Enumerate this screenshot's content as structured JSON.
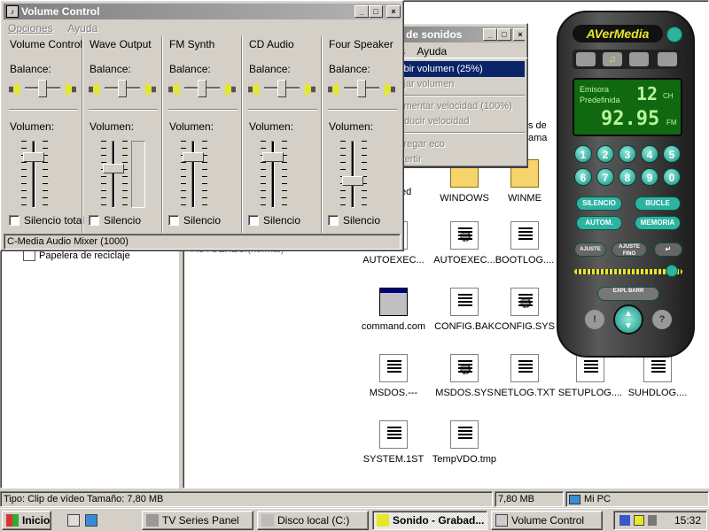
{
  "volume_control": {
    "title": "Volume Control",
    "menu": [
      "Opciones",
      "Ayuda"
    ],
    "channels": [
      {
        "name": "Volume Control",
        "balance_label": "Balance:",
        "volume_label": "Volumen:",
        "mute_label": "Silencio total",
        "volume_level": 0.8
      },
      {
        "name": "Wave Output",
        "balance_label": "Balance:",
        "volume_label": "Volumen:",
        "mute_label": "Silencio",
        "volume_level": 0.6
      },
      {
        "name": "FM Synth",
        "balance_label": "Balance:",
        "volume_label": "Volumen:",
        "mute_label": "Silencio",
        "volume_level": 0.8
      },
      {
        "name": "CD Audio",
        "balance_label": "Balance:",
        "volume_label": "Volumen:",
        "mute_label": "Silencio",
        "volume_level": 0.8
      },
      {
        "name": "Four Speaker",
        "balance_label": "Balance:",
        "volume_label": "Volumen:",
        "mute_label": "Silencio",
        "volume_level": 0.4
      }
    ],
    "status": "C-Media Audio Mixer (1000)"
  },
  "sound_window": {
    "title_partial": "de sonidos",
    "menu_partial": [
      "s",
      "Ayuda"
    ],
    "menu_items": [
      {
        "label": "Subir volumen (25%)",
        "highlighted": true
      },
      {
        "label": "Bajar volumen",
        "highlighted": false
      },
      {
        "label": "Aumentar velocidad (100%)",
        "highlighted": false
      },
      {
        "label": "Reducir velocidad",
        "highlighted": false
      },
      {
        "label": "Agregar eco",
        "highlighted": false
      },
      {
        "label": "Invertir",
        "highlighted": false
      }
    ]
  },
  "explorer": {
    "tree_item": "Papelera de reciclaje",
    "partial_texts": {
      "right_col": "s de",
      "right_col2": "ama",
      "left_col": "ed",
      "under_mixer": "AUTOEXEC.(normal)"
    },
    "icons": [
      {
        "label": "WINDOWS",
        "kind": "folder"
      },
      {
        "label": "WINME",
        "kind": "folder"
      },
      {
        "label": "AUTOEXEC...",
        "kind": "doc"
      },
      {
        "label": "AUTOEXEC...",
        "kind": "gear"
      },
      {
        "label": "BOOTLOG....",
        "kind": "doc"
      },
      {
        "label": "command.com",
        "kind": "win"
      },
      {
        "label": "CONFIG.BAK",
        "kind": "doc"
      },
      {
        "label": "CONFIG.SYS",
        "kind": "gear"
      },
      {
        "label": "MSDOS.---",
        "kind": "doc"
      },
      {
        "label": "MSDOS.SYS",
        "kind": "gear"
      },
      {
        "label": "NETLOG.TXT",
        "kind": "text"
      },
      {
        "label": "SETUPLOG....",
        "kind": "text"
      },
      {
        "label": "SUHDLOG....",
        "kind": "doc"
      },
      {
        "label": "SYSTEM.1ST",
        "kind": "doc"
      },
      {
        "label": "TempVDO.tmp",
        "kind": "doc"
      }
    ],
    "status": {
      "left": "Tipo: Clip de vídeo Tamaño: 7,80 MB",
      "size": "7,80 MB",
      "location": "Mi PC"
    }
  },
  "avermedia": {
    "brand": "AVerMedia",
    "display": {
      "line1": "Emisora",
      "line2": "Predefinida",
      "channel": "12",
      "channel_unit": "CH",
      "frequency": "92.95",
      "freq_unit": "FM"
    },
    "numbers": [
      "1",
      "2",
      "3",
      "4",
      "5",
      "6",
      "7",
      "8",
      "9",
      "0"
    ],
    "buttons": {
      "mute": "SILENCIO",
      "loop": "BUCLE",
      "auto": "AUTOM.",
      "memory": "MEMORIA",
      "fine_down": "AJUSTE",
      "fine_up": "AJUSTE FINO",
      "scan": "EXPL BARR"
    },
    "volume_level": 0.9
  },
  "taskbar": {
    "start": "Inicio",
    "tasks": [
      "TV Series Panel",
      "Disco local (C:)",
      "Sonido - Grabad...",
      "Volume Control"
    ],
    "clock": "15:32"
  }
}
